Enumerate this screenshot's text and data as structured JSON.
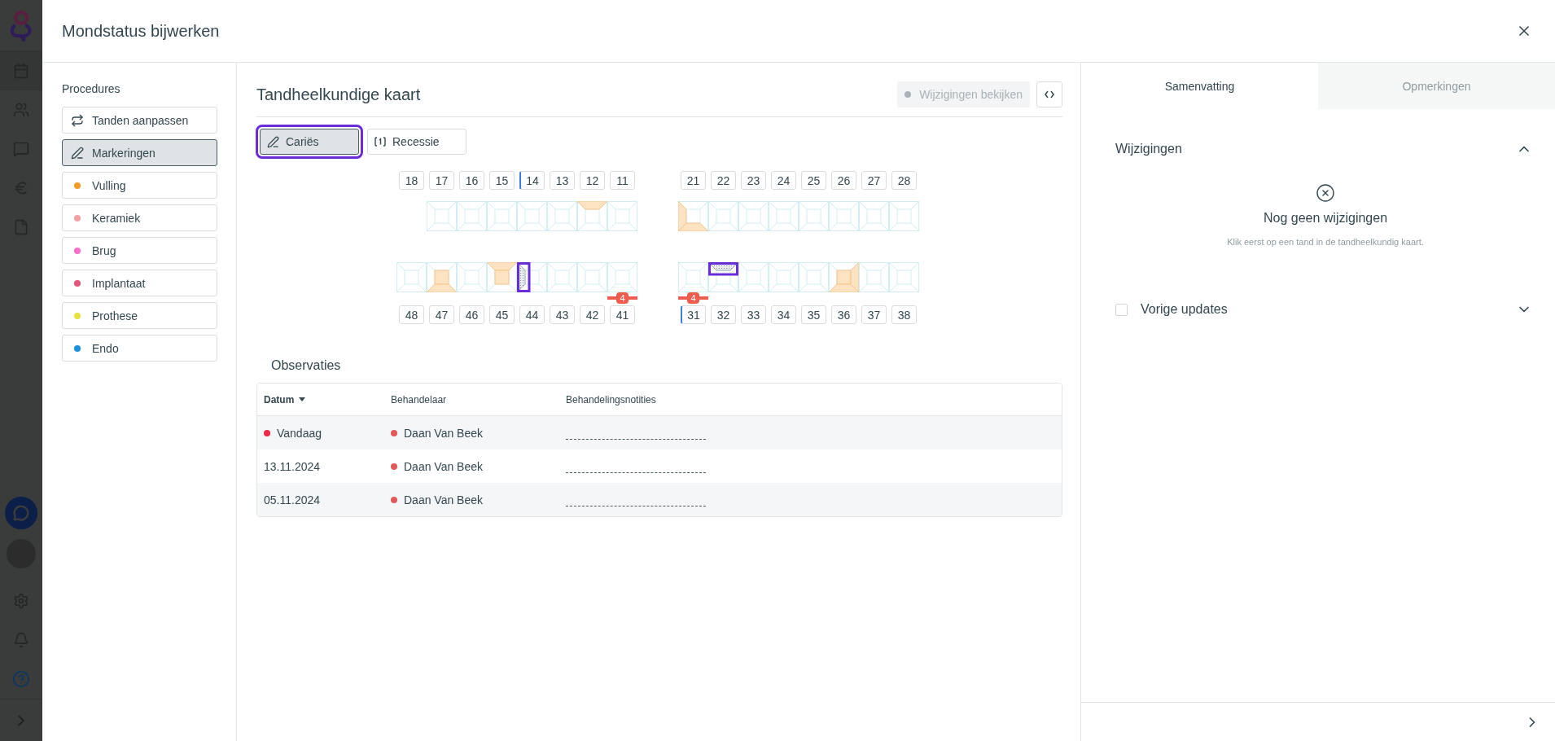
{
  "modal": {
    "title": "Mondstatus bijwerken"
  },
  "procedures": {
    "title": "Procedures",
    "items": [
      {
        "kind": "swap",
        "label": "Tanden aanpassen",
        "selected": false
      },
      {
        "kind": "pencil",
        "label": "Markeringen",
        "selected": true
      },
      {
        "kind": "dot",
        "label": "Vulling",
        "selected": false,
        "color": "#f59a23"
      },
      {
        "kind": "dot",
        "label": "Keramiek",
        "selected": false,
        "color": "#f4a0a4"
      },
      {
        "kind": "dot",
        "label": "Brug",
        "selected": false,
        "color": "#ff6ec7"
      },
      {
        "kind": "dot",
        "label": "Implantaat",
        "selected": false,
        "color": "#e85479"
      },
      {
        "kind": "dot",
        "label": "Prothese",
        "selected": false,
        "color": "#e5e23c"
      },
      {
        "kind": "dot",
        "label": "Endo",
        "selected": false,
        "color": "#1a8fdc"
      }
    ]
  },
  "chart": {
    "title": "Tandheelkundige kaart",
    "review_button": {
      "label": "Wijzigingen bekijken",
      "disabled": true
    },
    "tools": [
      {
        "kind": "pencil",
        "label": "Cariës",
        "selected": true
      },
      {
        "kind": "recession",
        "label": "Recessie",
        "selected": false
      }
    ],
    "upper_left": [
      {
        "number": "18",
        "missing": true,
        "indicator": false
      },
      {
        "number": "17",
        "missing": false,
        "indicator": false
      },
      {
        "number": "16",
        "missing": false,
        "indicator": false
      },
      {
        "number": "15",
        "missing": false,
        "indicator": false
      },
      {
        "number": "14",
        "missing": false,
        "indicator": true
      },
      {
        "number": "13",
        "missing": false,
        "indicator": false
      },
      {
        "number": "12",
        "missing": false,
        "indicator": false,
        "filling": {
          "kind": "top"
        }
      },
      {
        "number": "11",
        "missing": false,
        "indicator": false
      }
    ],
    "upper_right": [
      {
        "number": "21",
        "missing": false,
        "indicator": false,
        "filling": {
          "kind": "left_bottom"
        }
      },
      {
        "number": "22",
        "missing": false,
        "indicator": false
      },
      {
        "number": "23",
        "missing": false,
        "indicator": false
      },
      {
        "number": "24",
        "missing": false,
        "indicator": false
      },
      {
        "number": "25",
        "missing": false,
        "indicator": false
      },
      {
        "number": "26",
        "missing": false,
        "indicator": false
      },
      {
        "number": "27",
        "missing": false,
        "indicator": false
      },
      {
        "number": "28",
        "missing": false,
        "indicator": false
      }
    ],
    "lower_left": [
      {
        "number": "48",
        "missing": false,
        "indicator": false
      },
      {
        "number": "47",
        "missing": false,
        "indicator": false,
        "filling": {
          "kind": "center_bottom"
        }
      },
      {
        "number": "46",
        "missing": false,
        "indicator": false
      },
      {
        "number": "45",
        "missing": false,
        "indicator": false,
        "filling": {
          "kind": "top_center"
        }
      },
      {
        "number": "44",
        "missing": false,
        "indicator": false,
        "caries": {
          "kind": "left",
          "selected": true
        }
      },
      {
        "number": "43",
        "missing": false,
        "indicator": false
      },
      {
        "number": "42",
        "missing": false,
        "indicator": false
      },
      {
        "number": "41",
        "missing": false,
        "indicator": false,
        "pocket": "4"
      }
    ],
    "lower_right": [
      {
        "number": "31",
        "missing": false,
        "indicator": true,
        "pocket": "4"
      },
      {
        "number": "32",
        "missing": false,
        "indicator": false,
        "caries": {
          "kind": "top",
          "selected": true
        }
      },
      {
        "number": "33",
        "missing": false,
        "indicator": false
      },
      {
        "number": "34",
        "missing": false,
        "indicator": false
      },
      {
        "number": "35",
        "missing": false,
        "indicator": false
      },
      {
        "number": "36",
        "missing": false,
        "indicator": false,
        "filling": {
          "kind": "center_right_bottom"
        }
      },
      {
        "number": "37",
        "missing": false,
        "indicator": false
      },
      {
        "number": "38",
        "missing": false,
        "indicator": false
      }
    ]
  },
  "observations": {
    "title": "Observaties",
    "columns": [
      {
        "label": "Datum",
        "sorted": true
      },
      {
        "label": "Behandelaar",
        "sorted": false
      },
      {
        "label": "Behandelingsnotities",
        "sorted": false
      }
    ],
    "rows": [
      {
        "date": "Vandaag",
        "new": true,
        "practitioner": "Daan Van Beek",
        "color": "#e05a5a"
      },
      {
        "date": "13.11.2024",
        "new": false,
        "practitioner": "Daan Van Beek",
        "color": "#e05a5a"
      },
      {
        "date": "05.11.2024",
        "new": false,
        "practitioner": "Daan Van Beek",
        "color": "#e05a5a"
      }
    ]
  },
  "summary": {
    "tabs": [
      {
        "label": "Samenvatting",
        "selected": true
      },
      {
        "label": "Opmerkingen",
        "selected": false
      }
    ],
    "changes": {
      "title": "Wijzigingen",
      "expanded": true,
      "empty_title": "Nog geen wijzigingen",
      "empty_text": "Klik eerst op een tand in de tandheelkundig kaart."
    },
    "previous": {
      "title": "Vorige updates",
      "checked": false,
      "expanded": false
    }
  }
}
